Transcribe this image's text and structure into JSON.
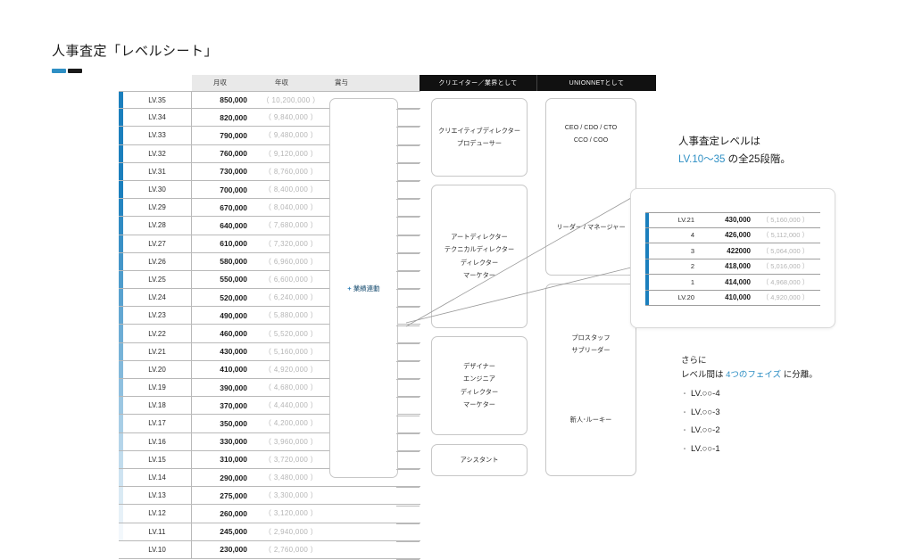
{
  "title": "人事査定「レベルシート」",
  "table": {
    "headers": {
      "level": "",
      "monthly": "月収",
      "yearly": "年収",
      "bonus": "賞与"
    },
    "bonus_note": "業績連動",
    "bonus_plus": "+",
    "rows": [
      {
        "level": "LV.35",
        "monthly": "850,000",
        "yearly": "（ 10,200,000 ）"
      },
      {
        "level": "LV.34",
        "monthly": "820,000",
        "yearly": "（ 9,840,000 ）"
      },
      {
        "level": "LV.33",
        "monthly": "790,000",
        "yearly": "（ 9,480,000 ）"
      },
      {
        "level": "LV.32",
        "monthly": "760,000",
        "yearly": "（ 9,120,000 ）"
      },
      {
        "level": "LV.31",
        "monthly": "730,000",
        "yearly": "（ 8,760,000 ）"
      },
      {
        "level": "LV.30",
        "monthly": "700,000",
        "yearly": "（ 8,400,000 ）"
      },
      {
        "level": "LV.29",
        "monthly": "670,000",
        "yearly": "（ 8,040,000 ）"
      },
      {
        "level": "LV.28",
        "monthly": "640,000",
        "yearly": "（ 7,680,000 ）"
      },
      {
        "level": "LV.27",
        "monthly": "610,000",
        "yearly": "（ 7,320,000 ）"
      },
      {
        "level": "LV.26",
        "monthly": "580,000",
        "yearly": "（ 6,960,000 ）"
      },
      {
        "level": "LV.25",
        "monthly": "550,000",
        "yearly": "（ 6,600,000 ）"
      },
      {
        "level": "LV.24",
        "monthly": "520,000",
        "yearly": "（ 6,240,000 ）"
      },
      {
        "level": "LV.23",
        "monthly": "490,000",
        "yearly": "（ 5,880,000 ）"
      },
      {
        "level": "LV.22",
        "monthly": "460,000",
        "yearly": "（ 5,520,000 ）"
      },
      {
        "level": "LV.21",
        "monthly": "430,000",
        "yearly": "（ 5,160,000 ）"
      },
      {
        "level": "LV.20",
        "monthly": "410,000",
        "yearly": "（ 4,920,000 ）"
      },
      {
        "level": "LV.19",
        "monthly": "390,000",
        "yearly": "（ 4,680,000 ）"
      },
      {
        "level": "LV.18",
        "monthly": "370,000",
        "yearly": "（ 4,440,000 ）"
      },
      {
        "level": "LV.17",
        "monthly": "350,000",
        "yearly": "（ 4,200,000 ）"
      },
      {
        "level": "LV.16",
        "monthly": "330,000",
        "yearly": "（ 3,960,000 ）"
      },
      {
        "level": "LV.15",
        "monthly": "310,000",
        "yearly": "（ 3,720,000 ）"
      },
      {
        "level": "LV.14",
        "monthly": "290,000",
        "yearly": "（ 3,480,000 ）"
      },
      {
        "level": "LV.13",
        "monthly": "275,000",
        "yearly": "（ 3,300,000 ）"
      },
      {
        "level": "LV.12",
        "monthly": "260,000",
        "yearly": "（ 3,120,000 ）"
      },
      {
        "level": "LV.11",
        "monthly": "245,000",
        "yearly": "（ 2,940,000 ）"
      },
      {
        "level": "LV.10",
        "monthly": "230,000",
        "yearly": "（ 2,760,000 ）"
      }
    ]
  },
  "columns": {
    "creator_header": "クリエイター／業界として",
    "unionnet_header": "UNIONNETとして"
  },
  "creator_boxes": [
    {
      "lines": [
        "クリエイティブディレクター",
        "プロデューサー"
      ]
    },
    {
      "lines": [
        "アートディレクター",
        "テクニカルディレクター",
        "ディレクター",
        "マーケター"
      ]
    },
    {
      "lines": [
        "デザイナー",
        "エンジニア",
        "ディレクター",
        "マーケター"
      ]
    },
    {
      "lines": [
        "アシスタント"
      ]
    }
  ],
  "unionnet_boxes": [
    {
      "top_lines": [
        "CEO / CDO / CTO",
        "CCO / COO"
      ],
      "bottom_lines": [
        "リーダー / マネージャー"
      ]
    },
    {
      "top_lines": [
        "プロスタッフ",
        "サブリーダー"
      ],
      "bottom_lines": [
        "新人･ルーキー"
      ]
    }
  ],
  "notes": {
    "line1": "人事査定レベルは",
    "line2_accent": "LV.10〜35",
    "line2_rest": " の全25段階。",
    "line3": "さらに",
    "line4_pre": "レベル間は ",
    "line4_accent": "4つのフェイズ",
    "line4_post": " に分離。",
    "bullets": [
      "LV.○○-4",
      "LV.○○-3",
      "LV.○○-2",
      "LV.○○-1"
    ],
    "bullet_mark": "・"
  },
  "callout": {
    "rows": [
      {
        "level": "LV.21",
        "monthly": "430,000",
        "yearly": "（ 5,160,000 ）"
      },
      {
        "level": "4",
        "monthly": "426,000",
        "yearly": "（ 5,112,000 ）"
      },
      {
        "level": "3",
        "monthly": "422000",
        "yearly": "（ 5,064,000 ）"
      },
      {
        "level": "2",
        "monthly": "418,000",
        "yearly": "（ 5,016,000 ）"
      },
      {
        "level": "1",
        "monthly": "414,000",
        "yearly": "（ 4,968,000 ）"
      },
      {
        "level": "LV.20",
        "monthly": "410,000",
        "yearly": "（ 4,920,000 ）"
      }
    ]
  },
  "colors": {
    "accent_blue": "#2e8fc4",
    "bar_blue": "#1b7fbd",
    "header_gray": "#e9e9e9",
    "black_bar": "#111111"
  }
}
